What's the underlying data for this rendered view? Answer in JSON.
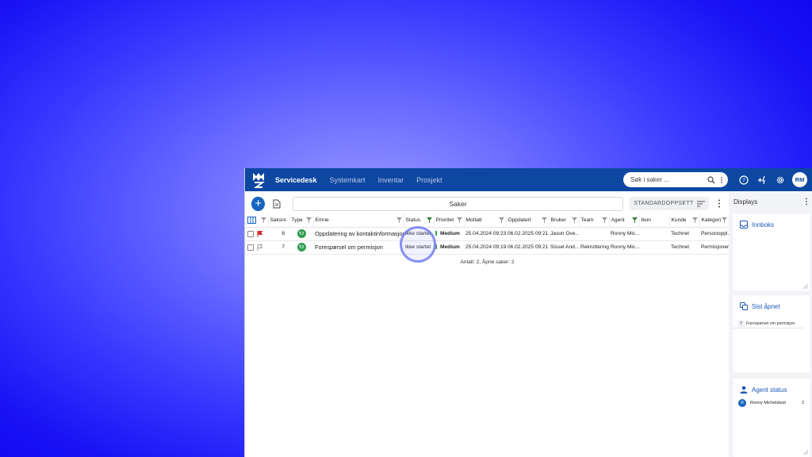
{
  "topbar": {
    "nav": [
      "Servicedesk",
      "Systemkart",
      "Inventar",
      "Prosjekt"
    ],
    "search_placeholder": "Søk i saker ...",
    "avatar_initials": "RM",
    "brand_color": "#0d47a1"
  },
  "toolbar": {
    "view_title": "Saker",
    "layout_label": "STANDARDOPPSETT"
  },
  "table": {
    "columns": [
      "Saksnr.",
      "Type",
      "Emne",
      "Status",
      "Prioritet",
      "Mottatt",
      "Oppdatert",
      "Bruker",
      "Team",
      "Agent",
      "Ikon",
      "Kunde",
      "Kategori"
    ],
    "rows": [
      {
        "num": "8",
        "type": "TJ",
        "subject": "Oppdatering av kontaktinformasjon",
        "status": "Ikke startet",
        "priority": "Medium",
        "received": "25.04.2024 09:23",
        "updated": "06.02.2025 09:21",
        "user": "Jason Ove...",
        "team": "",
        "agent": "Ronny Mic...",
        "icon": "",
        "customer": "Technet",
        "category": "Personoppl...",
        "flag": "red-flag"
      },
      {
        "num": "7",
        "type": "TJ",
        "subject": "Forespørsel om permisjon",
        "status": "Ikke startet",
        "priority": "Medium",
        "received": "25.04.2024 09:19",
        "updated": "06.02.2025 09:21",
        "user": "Sissel And...",
        "team": "Rekruttering -",
        "agent": "Ronny Mic...",
        "icon": "",
        "customer": "Technet",
        "category": "Permisjoner",
        "flag": "outline-flag"
      }
    ],
    "footer": "Antall: 2, Åpne saker: 2"
  },
  "sidebar": {
    "title": "Displays",
    "inbox_title": "Innboks",
    "recent_title": "Sist åpnet",
    "recent_item_num": "7",
    "recent_item_label": "Forespørsel om permisjon",
    "agent_status_title": "Agent status",
    "agent_initial": "R",
    "agent_name": "Ronny Michelstest",
    "agent_count": "2"
  }
}
